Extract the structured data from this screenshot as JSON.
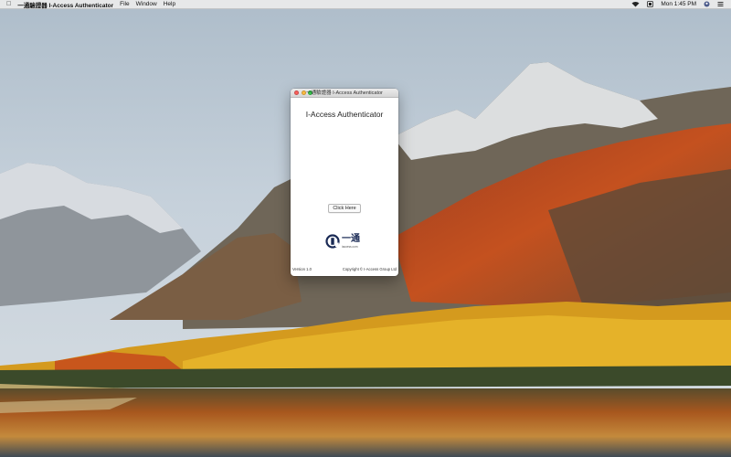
{
  "menubar": {
    "apple_icon": "apple-logo",
    "app_name": "一通驗證器 I-Access Authenticator",
    "menus": [
      "File",
      "Window",
      "Help"
    ],
    "status_icons": [
      "wifi-icon",
      "input-source-icon",
      "battery-icon"
    ],
    "time": "Mon 1:45 PM"
  },
  "window": {
    "title": "一通驗證器 I-Access Authenticator",
    "heading": "I-Access Authenticator",
    "button_label": "Click Here",
    "logo": {
      "brand": "一通",
      "url": "iaccess.com"
    },
    "version": "Version 1.0",
    "copyright": "Copyright © I-Access Group Ltd"
  },
  "colors": {
    "traffic_close": "#fc605c",
    "traffic_min": "#fdbc40",
    "traffic_max": "#34c84a",
    "logo_navy": "#1a2a55"
  }
}
